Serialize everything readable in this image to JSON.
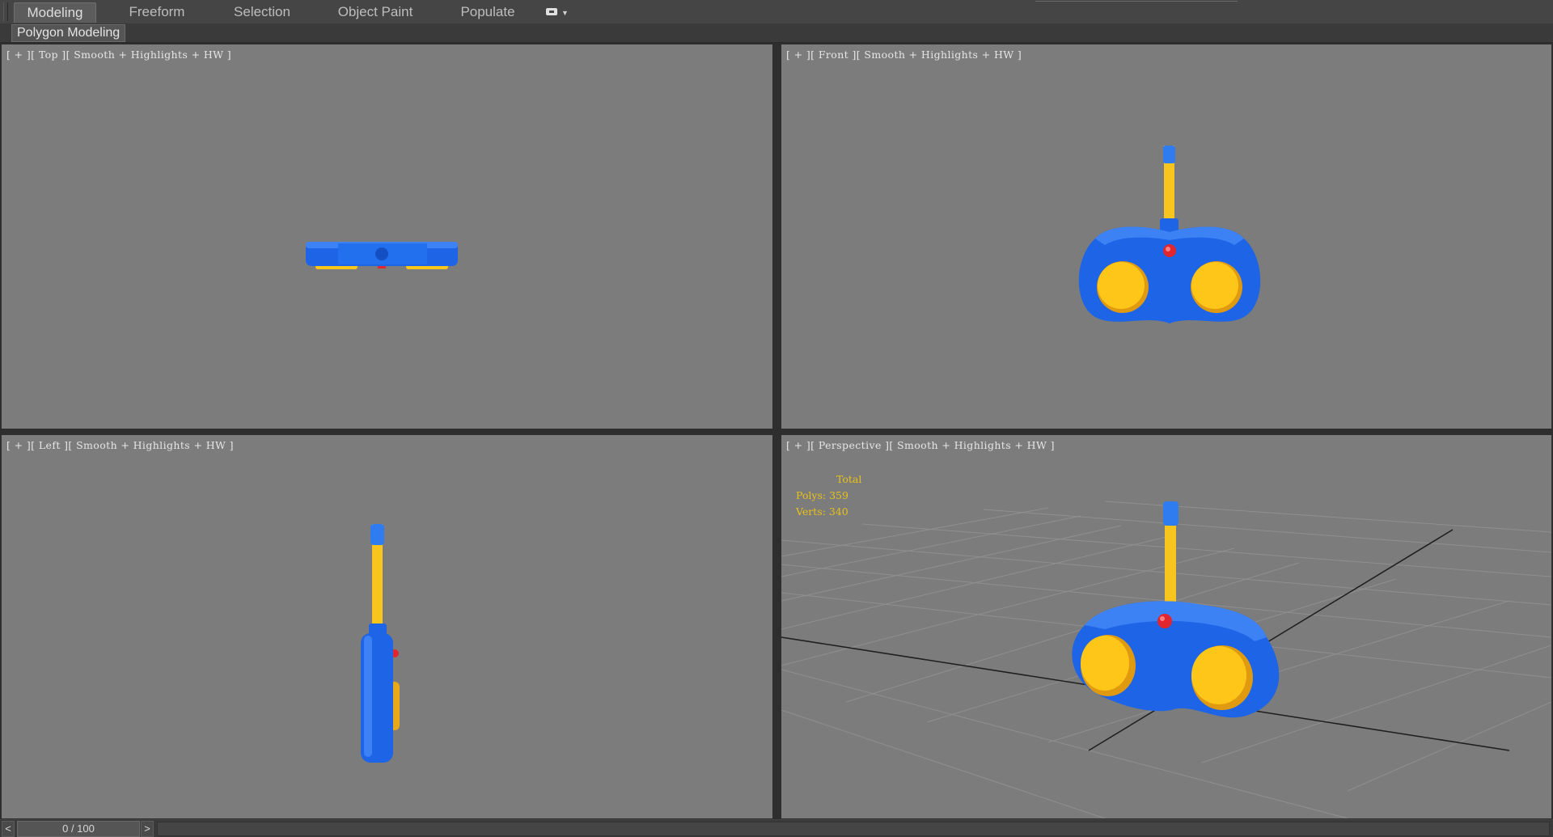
{
  "ribbon": {
    "tabs": [
      "Modeling",
      "Freeform",
      "Selection",
      "Object Paint",
      "Populate"
    ],
    "active_tab": "Modeling"
  },
  "panel_label": "Polygon Modeling",
  "viewports": {
    "top": {
      "label": "[ + ][ Top ][ Smooth + Highlights + HW ]"
    },
    "front": {
      "label": "[ + ][ Front ][ Smooth + Highlights + HW ]"
    },
    "left": {
      "label": "[ + ][ Left ][ Smooth + Highlights + HW ]"
    },
    "perspective": {
      "label": "[ + ][ Perspective ][ Smooth + Highlights + HW ]",
      "stats": {
        "header": "Total",
        "polys": "Polys: 359",
        "verts": "Verts: 340"
      }
    }
  },
  "timeline": {
    "frame": "0 / 100",
    "prev": "<",
    "next": ">"
  },
  "colors": {
    "viewport_bg": "#7c7c7c",
    "body_blue": "#1d64e6",
    "button_yellow": "#ffc61a",
    "antenna_yellow": "#f7c51d",
    "light_red": "#e2262f",
    "stats_yellow": "#e8c21a"
  }
}
